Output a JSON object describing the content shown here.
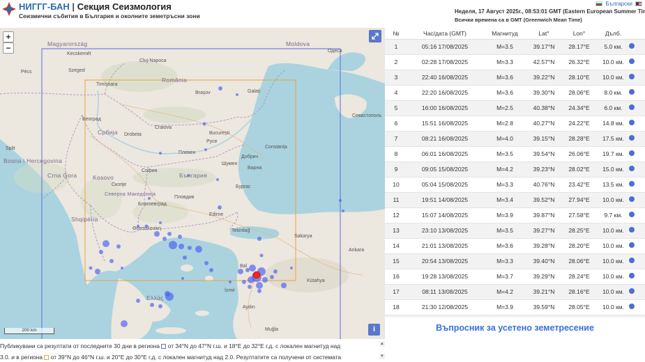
{
  "header": {
    "brand": "НИГГГ-БАН",
    "separator": "|",
    "section": "Секция Сеизмология",
    "tagline": "Сеизмични събития в България и околните земетръсни зони",
    "lang_bg": "Български",
    "datetime": "Неделя, 17 Август 2025г., 08:53:01 GMT (Eastern European Summer Time)",
    "tz_note": "Всички времена са в GMT (Greenwich Mean Time)"
  },
  "map": {
    "zoom_in": "+",
    "zoom_out": "−",
    "scale": "200 km",
    "fullscreen_icon": "expand-icon",
    "info_icon": "i",
    "labels": {
      "magyarorszag": "Magyarország",
      "romania": "România",
      "srbija": "Србија",
      "bulgaria": "България",
      "bosna": "Bosna i Hercegovina",
      "crna_gora": "Crna Gora",
      "kosovo": "Kosovo",
      "shqiperia": "Shqipëria",
      "north_macedonia": "Северна Македонија",
      "ellas": "Ελλάς",
      "moldova": "Moldova",
      "beograd": "Београд",
      "bucuresti": "București",
      "sofia": "София",
      "cluj": "Cluj-Napoca",
      "timisoara": "Timișoara",
      "brasov": "Brașov",
      "constanta": "Constanța",
      "varna": "Варна",
      "burgas": "Бургас",
      "plovdiv": "Пловдив",
      "craiova": "Craiova",
      "tekirdag": "Tekirdağ",
      "sakarya": "Sakarya",
      "ankara": "Ankara",
      "izmir": "İzmir",
      "aydin": "Aydın",
      "mugla": "Muğla",
      "balikesir": "Bal",
      "sevastopol": "Севастополь",
      "odesa": "Одеса",
      "split": "Split",
      "skopje": "Скопје",
      "thessaloniki": "Θεσσαλονίκη",
      "galati": "Galați",
      "kecskemet": "Kecskemét",
      "szeged": "Szeged",
      "pecs": "Pécs",
      "drobeta": "Drobeta",
      "pleven": "Плевен",
      "ruse": "Русе",
      "dobrich": "Добрич",
      "shumen": "Шумен",
      "blagoevgrad": "Благоевград",
      "edirne": "Edirne",
      "kutahya": "Kütahya"
    },
    "colors": {
      "land": "#ece7df",
      "sea": "#aad3df",
      "bbox_blue": "#5a6be0",
      "bbox_orange": "#e8a33a",
      "quake": "#4a5cf0",
      "latest": "#ff2222"
    }
  },
  "table": {
    "headers": [
      "№",
      "Час/дата (GMT)",
      "Магнитуд",
      "Lat°",
      "Lon°",
      "Дълб."
    ],
    "rows": [
      {
        "n": "1",
        "time": "05:16 17/08/2025",
        "mag": "M=3.5",
        "lat": "39.17°N",
        "lon": "28.17°E",
        "depth": "5.0 км."
      },
      {
        "n": "2",
        "time": "02:28 17/08/2025",
        "mag": "M=3.3",
        "lat": "42.57°N",
        "lon": "26.32°E",
        "depth": "10.0 км."
      },
      {
        "n": "3",
        "time": "22:40 16/08/2025",
        "mag": "M=3.6",
        "lat": "39.22°N",
        "lon": "28.10°E",
        "depth": "10.0 км."
      },
      {
        "n": "4",
        "time": "22:20 16/08/2025",
        "mag": "M=3.6",
        "lat": "39.30°N",
        "lon": "28.06°E",
        "depth": "8.0 км."
      },
      {
        "n": "5",
        "time": "16:00 16/08/2025",
        "mag": "M=2.5",
        "lat": "40.38°N",
        "lon": "24.34°E",
        "depth": "6.0 км."
      },
      {
        "n": "6",
        "time": "15:51 16/08/2025",
        "mag": "M=2.8",
        "lat": "40.27°N",
        "lon": "24.22°E",
        "depth": "14.8 км."
      },
      {
        "n": "7",
        "time": "08:21 16/08/2025",
        "mag": "M=4.0",
        "lat": "39.15°N",
        "lon": "28.28°E",
        "depth": "17.5 км."
      },
      {
        "n": "8",
        "time": "06:01 16/08/2025",
        "mag": "M=3.5",
        "lat": "39.54°N",
        "lon": "26.06°E",
        "depth": "19.7 км."
      },
      {
        "n": "9",
        "time": "09:05 15/08/2025",
        "mag": "M=4.2",
        "lat": "39.23°N",
        "lon": "28.02°E",
        "depth": "15.0 км."
      },
      {
        "n": "10",
        "time": "05:04 15/08/2025",
        "mag": "M=3.3",
        "lat": "40.76°N",
        "lon": "23.42°E",
        "depth": "13.5 км."
      },
      {
        "n": "11",
        "time": "19:51 14/08/2025",
        "mag": "M=3.4",
        "lat": "39.52°N",
        "lon": "27.94°E",
        "depth": "10.0 км."
      },
      {
        "n": "12",
        "time": "15:07 14/08/2025",
        "mag": "M=3.9",
        "lat": "39.87°N",
        "lon": "27.58°E",
        "depth": "9.7 км."
      },
      {
        "n": "13",
        "time": "23:10 13/08/2025",
        "mag": "M=3.5",
        "lat": "39.27°N",
        "lon": "28.25°E",
        "depth": "10.0 км."
      },
      {
        "n": "14",
        "time": "21:01 13/08/2025",
        "mag": "M=3.6",
        "lat": "39.28°N",
        "lon": "28.20°E",
        "depth": "10.0 км."
      },
      {
        "n": "15",
        "time": "20:54 13/08/2025",
        "mag": "M=3.3",
        "lat": "39.40°N",
        "lon": "28.06°E",
        "depth": "10.0 км."
      },
      {
        "n": "16",
        "time": "19:28 13/08/2025",
        "mag": "M=3.7",
        "lat": "39.29°N",
        "lon": "28.24°E",
        "depth": "10.0 км."
      },
      {
        "n": "17",
        "time": "08:11 13/08/2025",
        "mag": "M=4.2",
        "lat": "39.21°N",
        "lon": "28.16°E",
        "depth": "10.0 км."
      },
      {
        "n": "18",
        "time": "21:30 12/08/2025",
        "mag": "M=3.9",
        "lat": "39.59°N",
        "lon": "28.05°E",
        "depth": "10.0 км."
      },
      {
        "n": "19",
        "time": "20:43 12/08/2025",
        "mag": "M=3.1",
        "lat": "40.21°N",
        "lon": "24.13°E",
        "depth": "7.0 км."
      },
      {
        "n": "20",
        "time": "20:29 12/08/2025",
        "mag": "M=3.3",
        "lat": "40.28°N",
        "lon": "24.17°E",
        "depth": "12.3 км."
      }
    ],
    "report_link": "Въпросник за усетено земетресение"
  },
  "footer": {
    "line1_a": "Публикувани са резултати от последните 30 дни в региона",
    "line1_b": "от 34°N до 47°N г.ш. и 18°E до 32°E г.д. с локален магнитуд над",
    "line2_a": "3.0. и в региона",
    "line2_b": "от 39°N до 46°N г.ш. и 20°E до 30°E г.д. с локален магнитуд над 2.0. Резултатите са получени от системата"
  }
}
